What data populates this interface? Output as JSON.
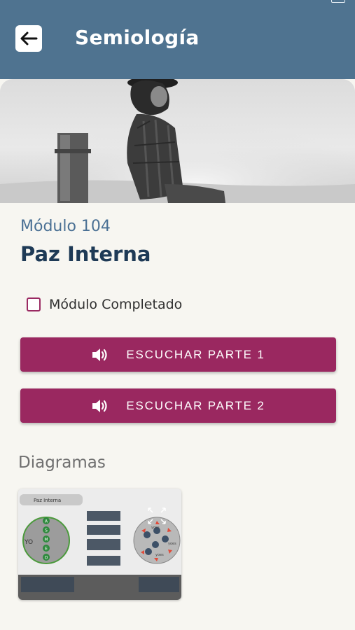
{
  "header": {
    "title": "Semiología",
    "back_icon": "arrow-left-icon",
    "color": "#4f7390"
  },
  "module": {
    "number": "Módulo 104",
    "name": "Paz Interna"
  },
  "completed": {
    "label": "Módulo Completado",
    "checked": false
  },
  "buttons": [
    {
      "label": "ESCUCHAR PARTE 1",
      "icon": "speaker-icon"
    },
    {
      "label": "ESCUCHAR PARTE 2",
      "icon": "speaker-icon"
    }
  ],
  "accent_color": "#9a2860",
  "diagrams": {
    "title": "Diagramas",
    "thumb_title": "Paz Interna",
    "center_label": "YO",
    "letters": [
      "A",
      "S",
      "M",
      "E",
      "O"
    ],
    "around_label": "yoes"
  }
}
